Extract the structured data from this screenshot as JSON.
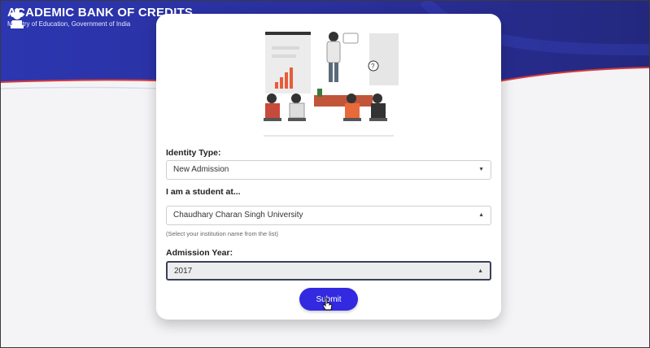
{
  "header": {
    "title": "ACADEMIC BANK OF CREDITS",
    "subtitle": "Ministry of Education, Government of India"
  },
  "form": {
    "identity_label": "Identity Type:",
    "identity_value": "New Admission",
    "student_label": "I am a student at...",
    "student_value": "Chaudhary Charan Singh University",
    "student_hint": "(Select your institution name from the list)",
    "year_label": "Admission Year:",
    "year_value": "2017",
    "submit_label": "Submit"
  },
  "colors": {
    "brand_blue": "#2a33a8",
    "submit_blue": "#3229e0",
    "accent_red": "#d63a3a"
  },
  "icons": {
    "emblem": "national-emblem-icon",
    "caret": "caret-icon",
    "cursor": "hand-pointer-icon"
  }
}
